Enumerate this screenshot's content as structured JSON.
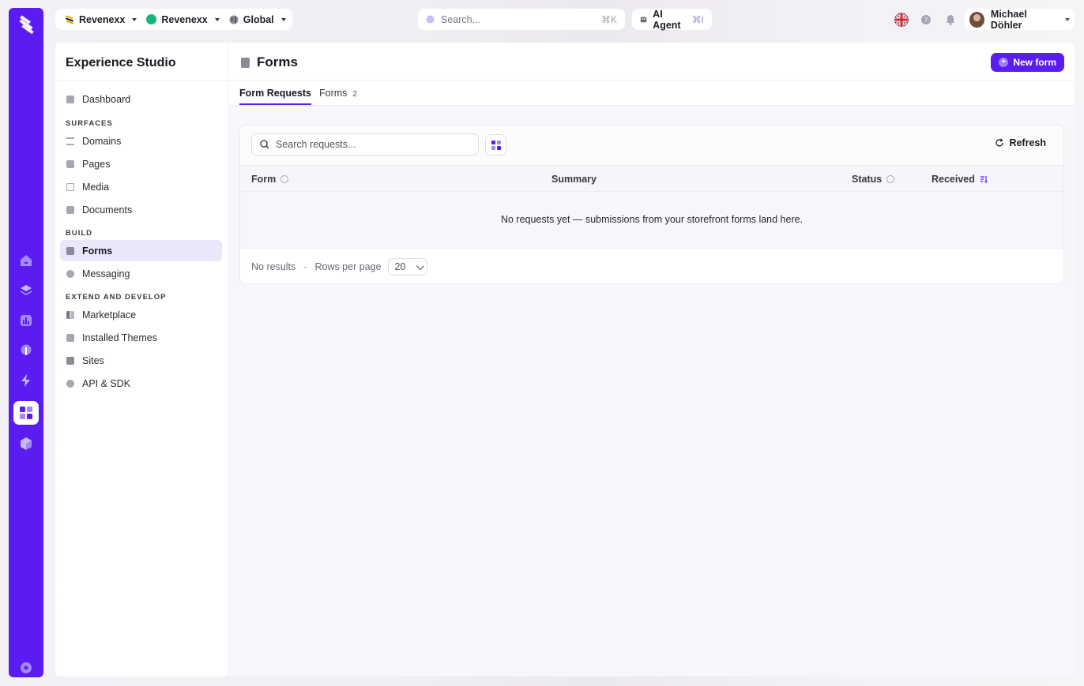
{
  "topbar": {
    "org_label": "Revenexx",
    "store_label": "Revenexx",
    "region_label": "Global",
    "search_placeholder": "Search...",
    "search_shortcut": "⌘K",
    "ai_agent_label": "AI Agent",
    "ai_agent_shortcut": "⌘I",
    "user_name": "Michael Döhler",
    "language": "en-GB"
  },
  "sidebar": {
    "title": "Experience Studio",
    "items": [
      {
        "label": "Dashboard"
      },
      {
        "section": "SURFACES"
      },
      {
        "label": "Domains"
      },
      {
        "label": "Pages"
      },
      {
        "label": "Media"
      },
      {
        "label": "Documents"
      },
      {
        "section": "BUILD"
      },
      {
        "label": "Forms",
        "active": true
      },
      {
        "label": "Messaging"
      },
      {
        "section": "EXTEND AND DEVELOP"
      },
      {
        "label": "Marketplace"
      },
      {
        "label": "Installed Themes"
      },
      {
        "label": "Sites"
      },
      {
        "label": "API & SDK"
      }
    ]
  },
  "page": {
    "title": "Forms",
    "new_button_label": "New form",
    "tabs": [
      {
        "label": "Form Requests",
        "active": true
      },
      {
        "label": "Forms",
        "count": "2"
      }
    ]
  },
  "table": {
    "search_placeholder": "Search requests...",
    "refresh_label": "Refresh",
    "columns": [
      "Form",
      "Summary",
      "Status",
      "Received"
    ],
    "empty_message": "No requests yet — submissions from your storefront forms land here.",
    "results_text": "No results",
    "separator": "-",
    "rows_per_page_label": "Rows per page",
    "rows_per_page_value": "20"
  },
  "colors": {
    "brand": "#5a1cf0",
    "active_nav": "#ece6fb",
    "status_green": "#15b77e"
  }
}
